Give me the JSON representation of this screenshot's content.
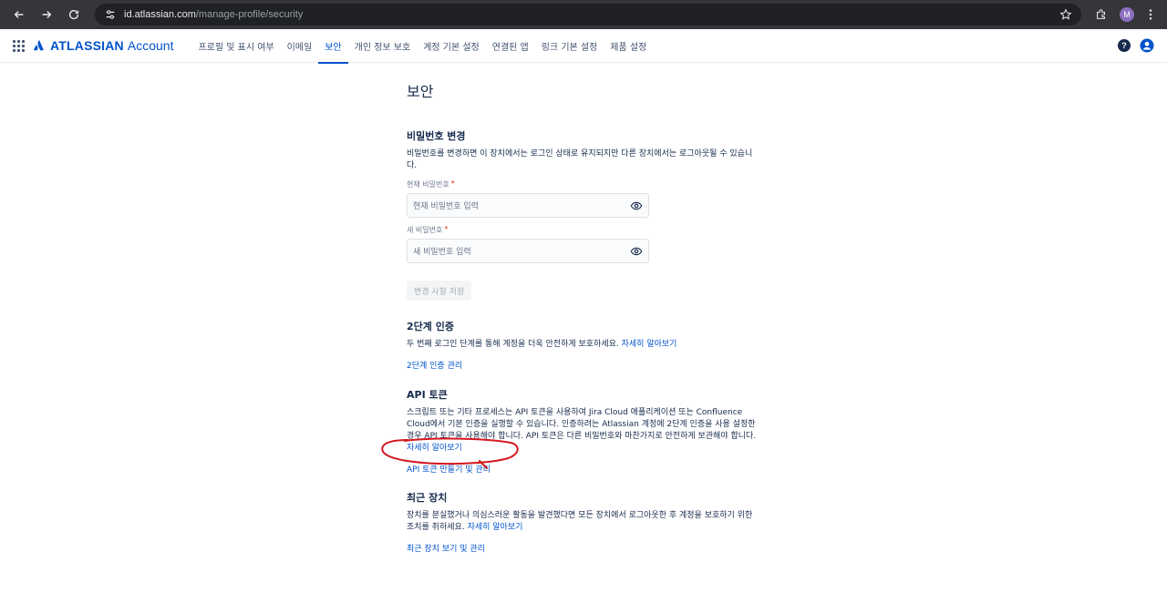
{
  "browser": {
    "url_host": "id.atlassian.com",
    "url_path": "/manage-profile/security",
    "profile_initial": "M"
  },
  "header": {
    "brand": "ATLASSIAN",
    "product": "Account",
    "tabs": [
      {
        "label": "프로필 및 표시 여부"
      },
      {
        "label": "이메일"
      },
      {
        "label": "보안"
      },
      {
        "label": "개인 정보 보호"
      },
      {
        "label": "계정 기본 설정"
      },
      {
        "label": "연결된 앱"
      },
      {
        "label": "링크 기본 설정"
      },
      {
        "label": "제품 설정"
      }
    ],
    "active_tab": "보안",
    "help_glyph": "?"
  },
  "main": {
    "title": "보안",
    "password": {
      "title": "비밀번호 변경",
      "description": "비밀번호를 변경하면 이 장치에서는 로그인 상태로 유지되지만 다른 장치에서는 로그아웃될 수 있습니다.",
      "current_label": "현재 비밀번호",
      "current_placeholder": "현재 비밀번호 입력",
      "new_label": "새 비밀번호",
      "new_placeholder": "새 비밀번호 입력",
      "required_mark": "*",
      "save_label": "변경 사항 저장"
    },
    "two_factor": {
      "title": "2단계 인증",
      "description": "두 번째 로그인 단계를 통해 계정을 더욱 안전하게 보호하세요.",
      "learn_more": "자세히 알아보기",
      "manage_link": "2단계 인증 관리"
    },
    "api_tokens": {
      "title": "API 토큰",
      "description": "스크립트 또는 기타 프로세스는 API 토큰을 사용하여 Jira Cloud 애플리케이션 또는 Confluence Cloud에서 기본 인증을 실행할 수 있습니다. 인증하려는 Atlassian 계정에 2단계 인증을 사용 설정한 경우 API 토큰을 사용해야 합니다. API 토큰은 다른 비밀번호와 마찬가지로 안전하게 보관해야 합니다.",
      "learn_more": "자세히 알아보기",
      "manage_link": "API 토큰 만들기 및 관리"
    },
    "recent_devices": {
      "title": "최근 장치",
      "description": "장치를 분실했거나 의심스러운 활동을 발견했다면 모든 장치에서 로그아웃한 후 계정을 보호하기 위한 조치를 취하세요.",
      "learn_more": "자세히 알아보기",
      "manage_link": "최근 장치 보기 및 관리"
    }
  },
  "colors": {
    "brand": "#0052cc",
    "text": "#172b4d",
    "annotation": "#d4181f"
  }
}
